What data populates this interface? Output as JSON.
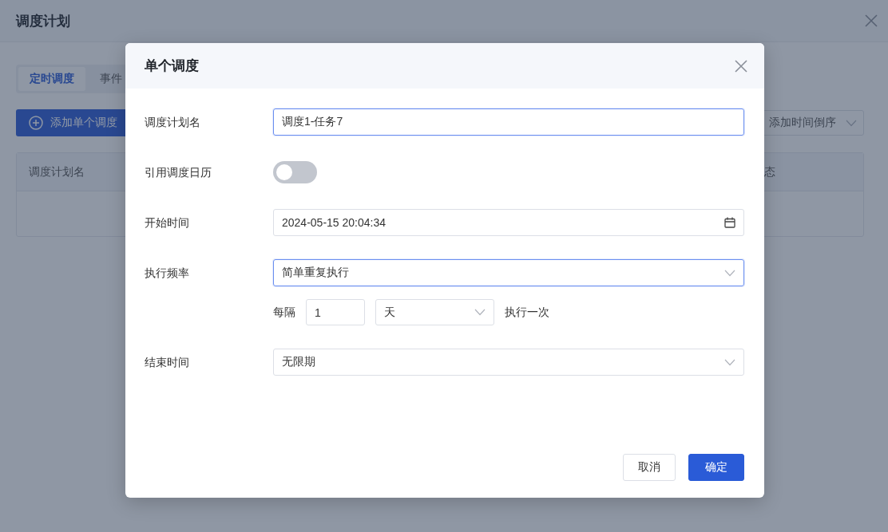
{
  "page": {
    "title": "调度计划",
    "tabs": [
      {
        "label": "定时调度",
        "selected": true
      },
      {
        "label": "事件",
        "selected": false
      }
    ],
    "add_button": "添加单个调度",
    "sort_select": {
      "value": "添加时间倒序"
    },
    "table": {
      "columns": [
        "调度计划名",
        "态"
      ]
    }
  },
  "dialog": {
    "title": "单个调度",
    "fields": [
      {
        "kind": "text",
        "label": "调度计划名",
        "value": "调度1-任务7",
        "focused": true
      },
      {
        "kind": "switch",
        "label": "引用调度日历",
        "on": false
      },
      {
        "kind": "datetime",
        "label": "开始时间",
        "value": "2024-05-15 20:04:34",
        "focused": false
      },
      {
        "kind": "select",
        "label": "执行频率",
        "value": "简单重复执行",
        "focused": true,
        "interval": {
          "prefix": "每隔",
          "count": "1",
          "unit": "天",
          "suffix": "执行一次"
        }
      },
      {
        "kind": "select",
        "label": "结束时间",
        "value": "无限期",
        "focused": false
      }
    ],
    "buttons": [
      {
        "label": "取消",
        "primary": false
      },
      {
        "label": "确定",
        "primary": true
      }
    ]
  }
}
